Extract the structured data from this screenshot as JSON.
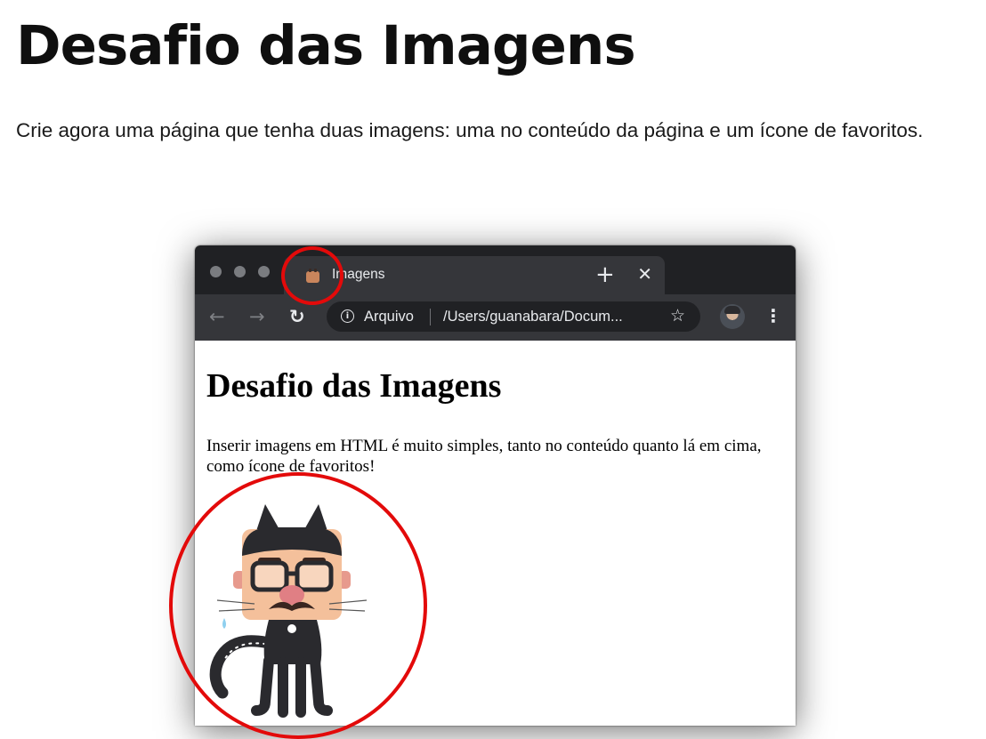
{
  "header": {
    "title": "Desafio das Imagens",
    "description": "Crie agora uma página que tenha duas imagens: uma no conteúdo da página e um ícone de favoritos."
  },
  "browser": {
    "tab": {
      "title": "Imagens",
      "close_icon": "close-icon"
    },
    "new_tab_icon": "plus-icon",
    "toolbar": {
      "back_icon": "arrow-left-icon",
      "forward_icon": "arrow-right-icon",
      "reload_icon": "reload-icon",
      "info_icon": "info-icon",
      "scheme_label": "Arquivo",
      "url": "/Users/guanabara/Docum...",
      "bookmark_icon": "star-icon",
      "menu_icon": "more-vertical-icon"
    },
    "page": {
      "heading": "Desafio das Imagens",
      "paragraph": "Inserir imagens em HTML é muito simples, tanto no conteúdo quanto lá em cima, como ícone de favoritos!"
    }
  },
  "colors": {
    "tabstrip": "#202124",
    "toolbar": "#35363a",
    "highlight": "#e30a0a"
  }
}
